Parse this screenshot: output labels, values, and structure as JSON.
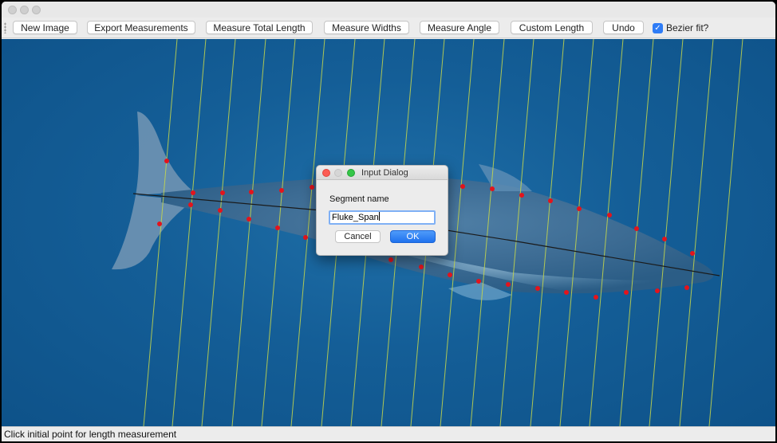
{
  "window": {
    "traffic_lights": [
      "close",
      "minimize",
      "zoom"
    ]
  },
  "toolbar": {
    "buttons": [
      {
        "label": "New Image"
      },
      {
        "label": "Export Measurements"
      },
      {
        "label": "Measure Total Length"
      },
      {
        "label": "Measure Widths"
      },
      {
        "label": "Measure Angle"
      },
      {
        "label": "Custom Length"
      },
      {
        "label": "Undo"
      }
    ],
    "bezier": {
      "label": "Bezier fit?",
      "checked": true
    }
  },
  "canvas": {
    "subject_icon": "whale-image",
    "line_color": "#c9d94a",
    "point_color": "#e3141c",
    "centerline_color": "#1a1a1a"
  },
  "dialog": {
    "title": "Input Dialog",
    "prompt": "Segment name",
    "input_value": "Fluke_Span",
    "cancel_label": "Cancel",
    "ok_label": "OK",
    "accent": "#2e7cf6"
  },
  "status": {
    "text": "Click initial point for length measurement"
  }
}
